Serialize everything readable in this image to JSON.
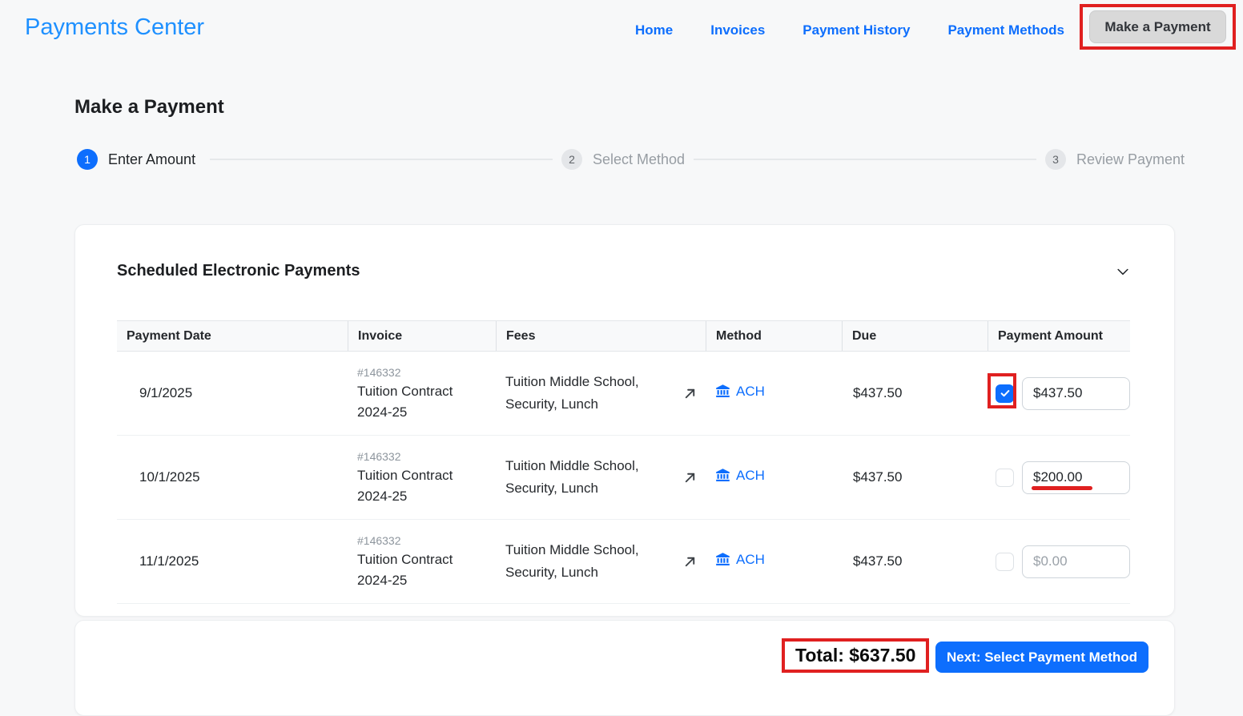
{
  "header": {
    "title": "Payments Center",
    "nav": [
      {
        "label": "Home"
      },
      {
        "label": "Invoices"
      },
      {
        "label": "Payment History"
      },
      {
        "label": "Payment Methods"
      }
    ],
    "make_payment_button": "Make a Payment"
  },
  "page": {
    "title": "Make a Payment"
  },
  "stepper": {
    "steps": [
      {
        "number": "1",
        "label": "Enter Amount",
        "active": true
      },
      {
        "number": "2",
        "label": "Select Method",
        "active": false
      },
      {
        "number": "3",
        "label": "Review Payment",
        "active": false
      }
    ]
  },
  "card": {
    "title": "Scheduled Electronic Payments",
    "collapse_icon": "chevron-down",
    "table": {
      "headers": [
        "Payment Date",
        "Invoice",
        "Fees",
        "Method",
        "Due",
        "Payment Amount"
      ],
      "rows": [
        {
          "date": "9/1/2025",
          "invoice_number": "#146332",
          "invoice_name": "Tuition Contract",
          "invoice_year": "2024-25",
          "fees": "Tuition Middle School, Security, Lunch",
          "method": "ACH",
          "due": "$437.50",
          "checked": true,
          "amount": "$437.50"
        },
        {
          "date": "10/1/2025",
          "invoice_number": "#146332",
          "invoice_name": "Tuition Contract",
          "invoice_year": "2024-25",
          "fees": "Tuition Middle School, Security, Lunch",
          "method": "ACH",
          "due": "$437.50",
          "checked": false,
          "amount": "$200.00"
        },
        {
          "date": "11/1/2025",
          "invoice_number": "#146332",
          "invoice_name": "Tuition Contract",
          "invoice_year": "2024-25",
          "fees": "Tuition Middle School, Security, Lunch",
          "method": "ACH",
          "due": "$437.50",
          "checked": false,
          "amount": "$0.00"
        }
      ]
    }
  },
  "footer": {
    "total_label": "Total: $637.50",
    "next_button": "Next: Select Payment Method"
  },
  "icons": {
    "bank": "bank-icon",
    "arrow": "arrow-up-right-icon",
    "chevron": "chevron-down-icon",
    "check": "check-icon"
  },
  "colors": {
    "accent_blue": "#0d6efd",
    "brand_blue": "#1e90ff",
    "annotation_red": "#e02020",
    "page_background": "#f7f8f9"
  },
  "annotations": {
    "highlighted_elements": [
      "make-a-payment-nav-button",
      "row-1-checkbox",
      "row-2-amount-underline",
      "total-amount"
    ]
  }
}
